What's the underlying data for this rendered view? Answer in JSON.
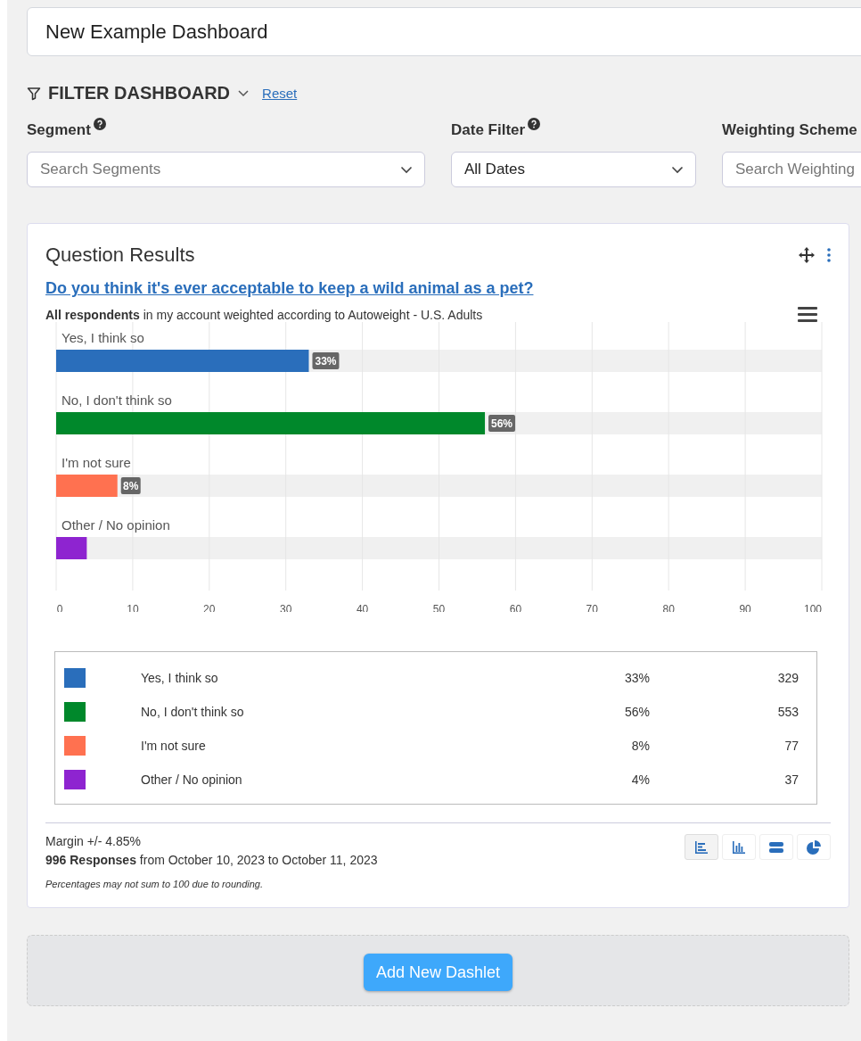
{
  "dashboard_title": "New Example Dashboard",
  "filter": {
    "heading": "FILTER DASHBOARD",
    "reset": "Reset",
    "fields": [
      {
        "label": "Segment",
        "help": true,
        "placeholder": "Search Segments"
      },
      {
        "label": "Date Filter",
        "help": true,
        "value": "All Dates"
      },
      {
        "label": "Weighting Scheme",
        "help": false,
        "placeholder": "Search Weighting"
      }
    ]
  },
  "dashlet": {
    "title": "Question Results",
    "question": "Do you think it's ever acceptable to keep a wild animal as a pet?",
    "subtitle": "**All respondents** in my account weighted according to Autoweight - U.S. Adults",
    "chart_data": {
      "type": "bar",
      "orientation": "horizontal",
      "categories": [
        "Yes, I think so",
        "No, I don't think so",
        "I'm not sure",
        "Other / No opinion"
      ],
      "values": [
        33,
        56,
        8,
        4
      ],
      "grid": true,
      "colors": [
        "#2a6ebb",
        "#00882b",
        "#ff7150",
        "#8e24d0"
      ],
      "value_labels": [
        "33%",
        "56%",
        "8%",
        null
      ],
      "xlim": [
        0,
        100
      ],
      "xticks": [
        0,
        10,
        20,
        30,
        40,
        50,
        60,
        70,
        80,
        90,
        100
      ]
    },
    "legend": [
      {
        "label": "Yes, I think so",
        "percent": "33%",
        "count": "329",
        "color": "#2a6ebb"
      },
      {
        "label": "No, I don't think so",
        "percent": "56%",
        "count": "553",
        "color": "#00882b"
      },
      {
        "label": "I'm not sure",
        "percent": "8%",
        "count": "77",
        "color": "#ff7150"
      },
      {
        "label": "Other / No opinion",
        "percent": "4%",
        "count": "37",
        "color": "#8e24d0"
      }
    ],
    "margin": "Margin +/- 4.85%",
    "responses": "**996 Responses** from October 10, 2023 to October 11, 2023",
    "note": "Percentages may not sum to 100 due to rounding.",
    "views": [
      {
        "kind": "horizontal-bars",
        "selected": true
      },
      {
        "kind": "vertical-bars",
        "selected": false
      },
      {
        "kind": "stacked",
        "selected": false
      },
      {
        "kind": "pie",
        "selected": false
      }
    ]
  },
  "add_button": "Add New Dashlet"
}
